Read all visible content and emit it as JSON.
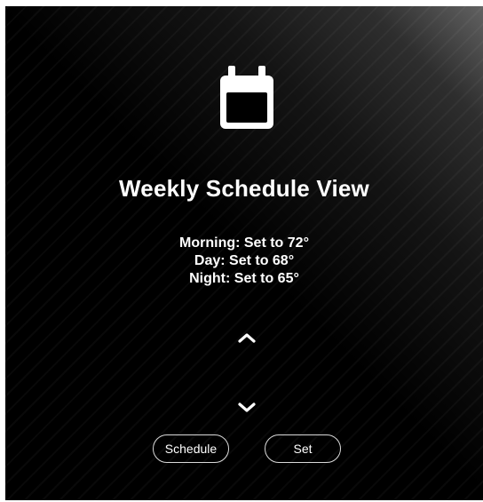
{
  "screen": {
    "title": "Weekly Schedule View",
    "icon": "calendar-icon"
  },
  "schedule": {
    "lines": [
      "Morning: Set to 72°",
      "Day: Set to 68°",
      "Night: Set to 65°"
    ]
  },
  "controls": {
    "up_icon": "chevron-up-icon",
    "down_icon": "chevron-down-icon"
  },
  "buttons": {
    "schedule_label": "Schedule",
    "set_label": "Set"
  },
  "colors": {
    "background": "#000000",
    "foreground": "#ffffff",
    "button_border": "#d9d9d9"
  }
}
